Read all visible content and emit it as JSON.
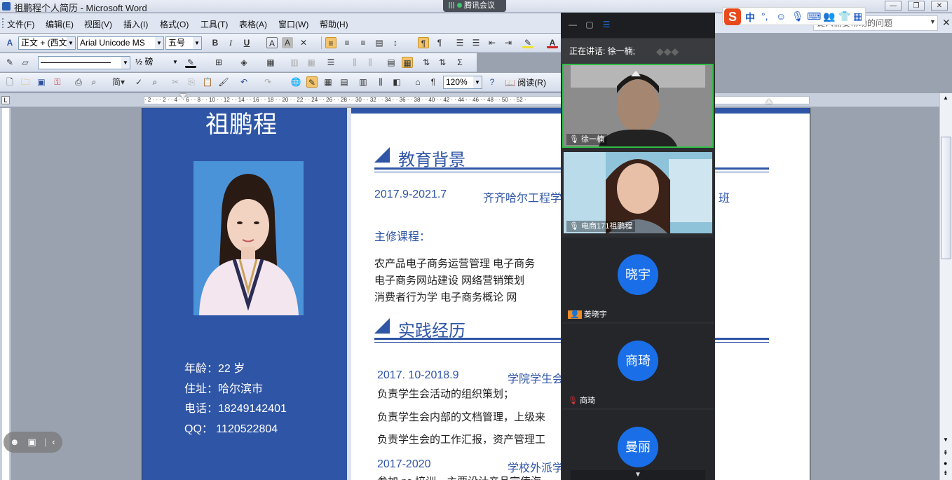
{
  "window": {
    "title": "祖鹏程个人简历 - Microsoft Word",
    "min_label": "—",
    "max_label": "❐",
    "close_label": "✕"
  },
  "meeting_pill": {
    "label": "腾讯会议"
  },
  "menu": {
    "items": [
      "文件(F)",
      "编辑(E)",
      "视图(V)",
      "插入(I)",
      "格式(O)",
      "工具(T)",
      "表格(A)",
      "窗口(W)",
      "帮助(H)"
    ]
  },
  "toolbar1": {
    "style_value": "正文 + (西文",
    "font_value": "Arial Unicode MS",
    "size_value": "五号"
  },
  "toolbar2": {
    "line_weight_value": "½ 磅"
  },
  "toolbar3": {
    "zoom_value": "120%",
    "read_label": "阅读(R)"
  },
  "search": {
    "placeholder": "键入需要帮助的问题"
  },
  "document": {
    "name": "祖鹏程",
    "info": [
      "年龄：22 岁",
      "住址：哈尔滨市",
      "电话：18249142401",
      "QQ：  1120522804"
    ],
    "education_title": "教育背景",
    "edu_date": "2017.9-2021.7",
    "edu_school": "齐齐哈尔工程学",
    "edu_class_tail": "班",
    "courses_label": "主修课程：",
    "courses": [
      "农产品电子商务运营管理    电子商务",
      "电子商务网站建设      网络营销策划",
      "消费者行为学     电子商务概论     网"
    ],
    "practice_title": "实践经历",
    "p1_date": "2017. 10-2018.9",
    "p1_org": "学院学生会",
    "p1_lines": [
      "负责学生会活动的组织策划；",
      "负责学生会内部的文档管理，上级来",
      "负责学生会的工作汇报，资产管理工"
    ],
    "p2_date": "2017-2020",
    "p2_org": "学校外派学",
    "p2_line": "参加 ps 培训，主要设计产品宣传海"
  },
  "meeting_panel": {
    "speaking": "正在讲话: 徐一楠;",
    "participants": [
      {
        "name": "徐一楠",
        "type": "video",
        "mic": "on"
      },
      {
        "name": "电商171祖鹏程",
        "type": "video",
        "mic": "on"
      },
      {
        "name": "姜晓宇",
        "avatar_text": "晓宇",
        "type": "avatar"
      },
      {
        "name": "商琦",
        "avatar_text": "商琦",
        "type": "avatar",
        "mic": "muted"
      },
      {
        "name": "曼丽",
        "avatar_text": "曼丽",
        "type": "avatar"
      }
    ],
    "accent": "#1a6fe8",
    "active_border": "#2fbf48"
  },
  "ime": {
    "logo": "S",
    "mode": "中",
    "punct": "°,"
  }
}
